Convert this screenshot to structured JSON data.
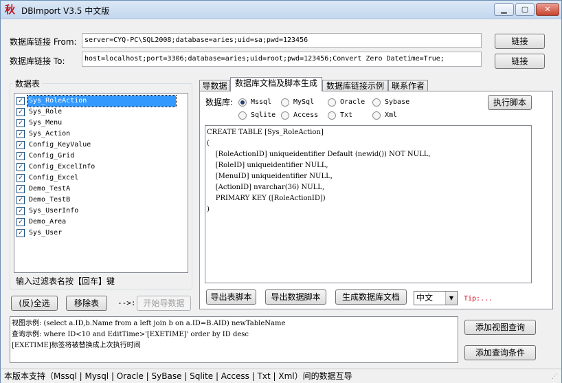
{
  "window": {
    "title": "DBImport V3.5 中文版",
    "icon_glyph": "秋",
    "minimize": "▁",
    "maximize": "▢",
    "close": "✕"
  },
  "connection": {
    "from_label": "数据库链接 From:",
    "from_value": "server=CYQ-PC\\SQL2008;database=aries;uid=sa;pwd=123456",
    "to_label": "数据库链接 To:",
    "to_value": "host=localhost;port=3306;database=aries;uid=root;pwd=123456;Convert Zero Datetime=True;",
    "connect_from_btn": "链接",
    "connect_to_btn": "链接"
  },
  "tables_group": {
    "title": "数据表",
    "items": [
      {
        "name": "Sys_RoleAction",
        "checked": true,
        "selected": true
      },
      {
        "name": "Sys_Role",
        "checked": true
      },
      {
        "name": "Sys_Menu",
        "checked": true
      },
      {
        "name": "Sys_Action",
        "checked": true
      },
      {
        "name": "Config_KeyValue",
        "checked": true
      },
      {
        "name": "Config_Grid",
        "checked": true
      },
      {
        "name": "Config_ExcelInfo",
        "checked": true
      },
      {
        "name": "Config_Excel",
        "checked": true
      },
      {
        "name": "Demo_TestA",
        "checked": true
      },
      {
        "name": "Demo_TestB",
        "checked": true
      },
      {
        "name": "Sys_UserInfo",
        "checked": true
      },
      {
        "name": "Demo_Area",
        "checked": true
      },
      {
        "name": "Sys_User",
        "checked": true
      }
    ],
    "filter_placeholder": "输入过滤表名按【回车】键",
    "select_all_btn": "(反)全选",
    "remove_btn": "移除表",
    "arrow_text": "-->:",
    "start_import_btn": "开始导数据"
  },
  "tabs": [
    {
      "label": "导数据",
      "active": false
    },
    {
      "label": "数据库文档及脚本生成",
      "active": true
    },
    {
      "label": "数据库链接示例",
      "active": false
    },
    {
      "label": "联系作者",
      "active": false
    }
  ],
  "script_tab": {
    "db_label": "数据库:",
    "db_options": [
      {
        "label": "Mssql",
        "checked": true
      },
      {
        "label": "MySql",
        "checked": false
      },
      {
        "label": "Oracle",
        "checked": false
      },
      {
        "label": "Sybase",
        "checked": false
      },
      {
        "label": "Sqlite",
        "checked": false
      },
      {
        "label": "Access",
        "checked": false
      },
      {
        "label": "Txt",
        "checked": false
      },
      {
        "label": "Xml",
        "checked": false
      }
    ],
    "exec_btn": "执行脚本",
    "code_lines": [
      "CREATE TABLE [Sys_RoleAction]",
      "(",
      "    [RoleActionID] uniqueidentifier Default (newid()) NOT NULL,",
      "    [RoleID] uniqueidentifier NULL,",
      "    [MenuID] uniqueidentifier NULL,",
      "    [ActionID] nvarchar(36) NULL,",
      "    PRIMARY KEY ([RoleActionID])",
      ")"
    ],
    "export_table_btn": "导出表脚本",
    "export_data_btn": "导出数据脚本",
    "gen_doc_btn": "生成数据库文档",
    "language_value": "中文",
    "tip_text": "Tip:..."
  },
  "query_box": {
    "lines": [
      "视图示例: (select a.ID,b.Name from a left join b on a.ID=B.AID) newTableName",
      "查询示例: where ID<10 and EditTime>'[EXETIME]' order by ID desc",
      "[EXETIME]标签将被替换成上次执行时间"
    ],
    "add_view_btn": "添加视图查询",
    "add_where_btn": "添加查询条件"
  },
  "statusbar": {
    "text": "本版本支持（Mssql | Mysql | Oracle | SyBase | Sqlite | Access | Txt | Xml）间的数据互导"
  }
}
